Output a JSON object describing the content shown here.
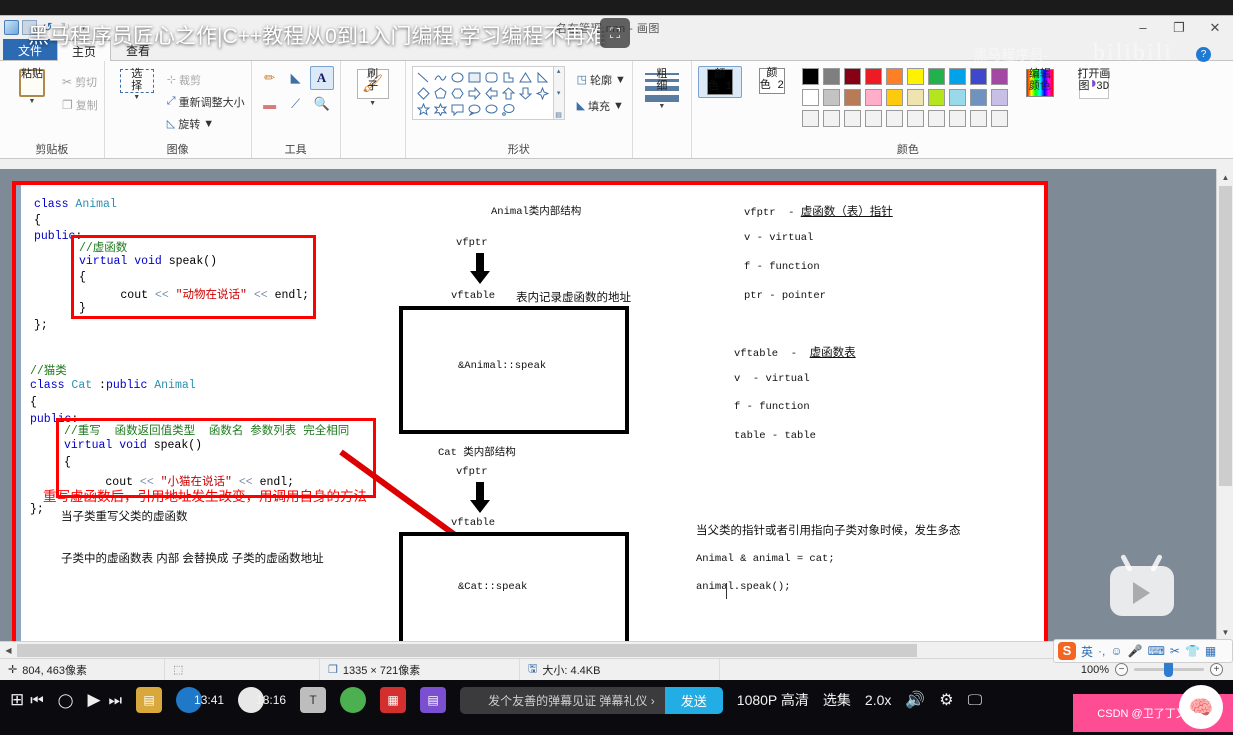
{
  "player": {
    "video_title": "黑马程序员匠心之作|C++教程从0到1入门编程,学习编程不再难",
    "web_fullscreen_icon": "web-fullscreen-icon",
    "watermark": "bilibili",
    "brand": "黑马程序员-",
    "help_icon": "?",
    "big_play_icon": "play-icon"
  },
  "window": {
    "quick_access": [
      "paint-app-icon",
      "save-icon",
      "undo-icon",
      "redo-icon",
      "customize-caret-icon"
    ],
    "caption": "名在管理 nnn - 画图",
    "minimize": "–",
    "restore": "❐",
    "close": "✕"
  },
  "tabs": [
    {
      "label": "文件",
      "name": "tab-file",
      "state": "file"
    },
    {
      "label": "主页",
      "name": "tab-home",
      "state": "active"
    },
    {
      "label": "查看",
      "name": "tab-view",
      "state": "normal"
    }
  ],
  "ribbon": {
    "clipboard": {
      "title": "剪贴板",
      "paste": "粘贴",
      "cut": "剪切",
      "copy": "复制"
    },
    "image": {
      "title": "图像",
      "select": "选\n择",
      "crop": "裁剪",
      "resize": "重新调整大小",
      "rotate": "旋转"
    },
    "tools": {
      "title": "工具",
      "icons": [
        "pencil-icon",
        "fill-icon",
        "text-icon",
        "eraser-icon",
        "color-picker-icon",
        "magnifier-icon"
      ]
    },
    "brushes": {
      "title": "",
      "label": "刷\n子"
    },
    "shapes": {
      "title": "形状",
      "outline": "轮廓",
      "fill": "填充"
    },
    "size": {
      "title": "",
      "label": "粗\n细"
    },
    "colors": {
      "title": "颜色",
      "color1": "颜\n色 1",
      "color2": "颜\n色 2",
      "color1_value": "#000000",
      "color2_value": "#ffffff",
      "edit_colors": "编辑\n颜色",
      "open_paint3d": "打开画\n图 3D",
      "row1": [
        "#000000",
        "#7f7f7f",
        "#880015",
        "#ed1c24",
        "#ff7f27",
        "#fff200",
        "#22b14c",
        "#00a2e8",
        "#3f48cc",
        "#a349a4"
      ],
      "row2": [
        "#ffffff",
        "#c3c3c3",
        "#b97a57",
        "#ffaec9",
        "#ffc90e",
        "#efe4b0",
        "#b5e61d",
        "#99d9ea",
        "#7092be",
        "#c8bfe7"
      ],
      "row3": [
        "#f2f2f2",
        "#f2f2f2",
        "#f2f2f2",
        "#f2f2f2",
        "#f2f2f2",
        "#f2f2f2",
        "#f2f2f2",
        "#f2f2f2",
        "#f2f2f2",
        "#f2f2f2"
      ]
    }
  },
  "statusbar": {
    "cursor_pos": "804, 463像素",
    "selection_icon": "selection-size-icon",
    "image_size": "1335 × 721像素",
    "file_size": "大小: 4.4KB",
    "zoom_level": "100%",
    "zoom_out": "−",
    "zoom_in": "+"
  },
  "canvas": {
    "code_block_1": {
      "lines": [
        [
          {
            "t": "class ",
            "c": "kw"
          },
          {
            "t": "Animal",
            "c": "ty"
          }
        ],
        [
          {
            "t": "{",
            "c": ""
          }
        ],
        [
          {
            "t": "public",
            "c": "kw"
          },
          {
            "t": ":",
            "c": ""
          }
        ]
      ],
      "boxed_lines": [
        [
          {
            "t": "//虚函数",
            "c": "cm"
          }
        ],
        [
          {
            "t": "virtual void ",
            "c": "kw"
          },
          {
            "t": "speak()",
            "c": ""
          }
        ],
        [
          {
            "t": "{",
            "c": ""
          }
        ],
        [
          {
            "t": "        cout ",
            "c": ""
          },
          {
            "t": "<< ",
            "c": "op"
          },
          {
            "t": "\"动物在说话\"",
            "c": "str"
          },
          {
            "t": " << ",
            "c": "op"
          },
          {
            "t": "endl;",
            "c": ""
          }
        ],
        [
          {
            "t": "}",
            "c": ""
          }
        ]
      ],
      "closing": "};"
    },
    "code_block_2": {
      "lines": [
        [
          {
            "t": "//猫类",
            "c": "cm"
          }
        ],
        [
          {
            "t": "class ",
            "c": "kw"
          },
          {
            "t": "Cat ",
            "c": "ty"
          },
          {
            "t": ":",
            "c": ""
          },
          {
            "t": "public ",
            "c": "kw"
          },
          {
            "t": "Animal",
            "c": "ty"
          }
        ],
        [
          {
            "t": "{",
            "c": ""
          }
        ],
        [
          {
            "t": "public",
            "c": "kw"
          },
          {
            "t": ":",
            "c": ""
          }
        ]
      ],
      "boxed_lines": [
        [
          {
            "t": "//重写  函数返回值类型  函数名 参数列表 完全相同",
            "c": "cm"
          }
        ],
        [
          {
            "t": "virtual void ",
            "c": "kw"
          },
          {
            "t": "speak()",
            "c": ""
          }
        ],
        [
          {
            "t": "{",
            "c": ""
          }
        ],
        [
          {
            "t": "        cout ",
            "c": ""
          },
          {
            "t": "<< ",
            "c": "op"
          },
          {
            "t": "\"小猫在说话\"",
            "c": "str"
          },
          {
            "t": " << ",
            "c": "op"
          },
          {
            "t": "endl;",
            "c": ""
          }
        ]
      ],
      "red_annotation": "重写虚函数后，引用地址发生改变，用调用自身的方法",
      "closing": "};"
    },
    "left_notes": [
      "当子类重写父类的虚函数",
      "子类中的虚函数表 内部 会替换成 子类的虚函数地址"
    ],
    "diagram": {
      "animal": {
        "title": "Animal类内部结构",
        "vfptr": "vfptr",
        "vftable": "vftable",
        "note": "表内记录虚函数的地址",
        "entry": "&Animal::speak"
      },
      "cat": {
        "title": "Cat 类内部结构",
        "vfptr": "vfptr",
        "vftable": "vftable",
        "entry": "&Cat::speak"
      }
    },
    "legend_top": [
      {
        "term": "vfptr",
        "dash": "-",
        "desc": "虚函数（表）指针",
        "underline": true
      },
      {
        "term": "v",
        "dash": "-",
        "desc": "virtual",
        "underline": false
      },
      {
        "term": "f",
        "dash": "-",
        "desc": "function",
        "underline": false
      },
      {
        "term": "ptr",
        "dash": "-",
        "desc": "pointer",
        "underline": false
      }
    ],
    "legend_bottom": [
      {
        "term": "vftable",
        "dash": "-",
        "desc": "虚函数表",
        "underline": true
      },
      {
        "term": "v",
        "dash": "-",
        "desc": "virtual",
        "underline": false
      },
      {
        "term": "f",
        "dash": "-",
        "desc": "function",
        "underline": false
      },
      {
        "term": "table",
        "dash": "-",
        "desc": "table",
        "underline": false
      }
    ],
    "right_notes": [
      "当父类的指针或者引用指向子类对象时候，发生多态",
      "Animal & animal = cat;",
      "animal.speak();"
    ]
  },
  "ime": {
    "logo": "S",
    "items": [
      "英",
      "·,",
      "☺",
      "🎤",
      "⌨",
      "✂",
      "👕",
      "▦"
    ]
  },
  "bottom": {
    "taskbar_icons": [
      "windows-icon",
      "previous-icon",
      "record-icon",
      "play-icon",
      "next-icon",
      "folder-icon",
      "browser-icon",
      "chrome-icon",
      "text-icon",
      "green-app-icon",
      "red-app-icon",
      "purple-app-icon"
    ],
    "clock_1": "13:41",
    "clock_2": "18:16",
    "danmaku_placeholder": "发个友善的弹幕见证 弹幕礼仪 ›",
    "send_label": "发送",
    "quality": "1080P 高清",
    "episodes": "选集",
    "speed": "2.0x",
    "volume_icon": "volume-icon",
    "settings_icon": "gear-icon",
    "pip_icon": "picture-in-picture-icon",
    "watermark_text": "CSDN @卫了丁又繁野",
    "watermark_color": "#ff4d94"
  }
}
